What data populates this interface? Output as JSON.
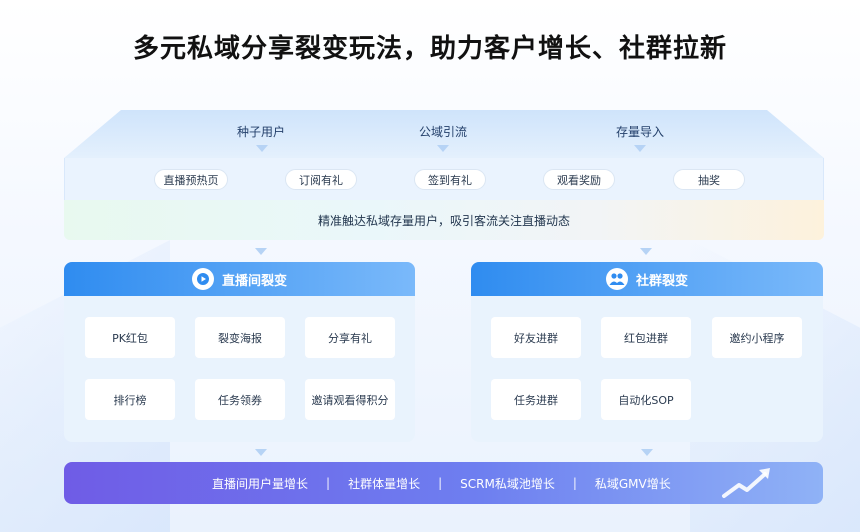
{
  "title": "多元私域分享裂变玩法，助力客户增长、社群拉新",
  "sources": [
    "种子用户",
    "公域引流",
    "存量导入"
  ],
  "tags": [
    "直播预热页",
    "订阅有礼",
    "签到有礼",
    "观看奖励",
    "抽奖"
  ],
  "highlight": "精准触达私域存量用户，吸引客流关注直播动态",
  "panels": {
    "live": {
      "title": "直播间裂变",
      "icon": "video-play-icon",
      "items": [
        "PK红包",
        "裂变海报",
        "分享有礼",
        "排行榜",
        "任务领券",
        "邀请观看得积分"
      ]
    },
    "community": {
      "title": "社群裂变",
      "icon": "group-users-icon",
      "items": [
        "好友进群",
        "红包进群",
        "邀约小程序",
        "任务进群",
        "自动化SOP"
      ]
    }
  },
  "results": [
    "直播间用户量增长",
    "社群体量增长",
    "SCRM私域池增长",
    "私域GMV增长"
  ],
  "result_separator": "|",
  "growth_icon": "trend-up-arrow-icon",
  "colors": {
    "primary_blue": "#2f8cf0",
    "purple_start": "#6f5ce6",
    "panel_bg": "#e9f3fd"
  }
}
